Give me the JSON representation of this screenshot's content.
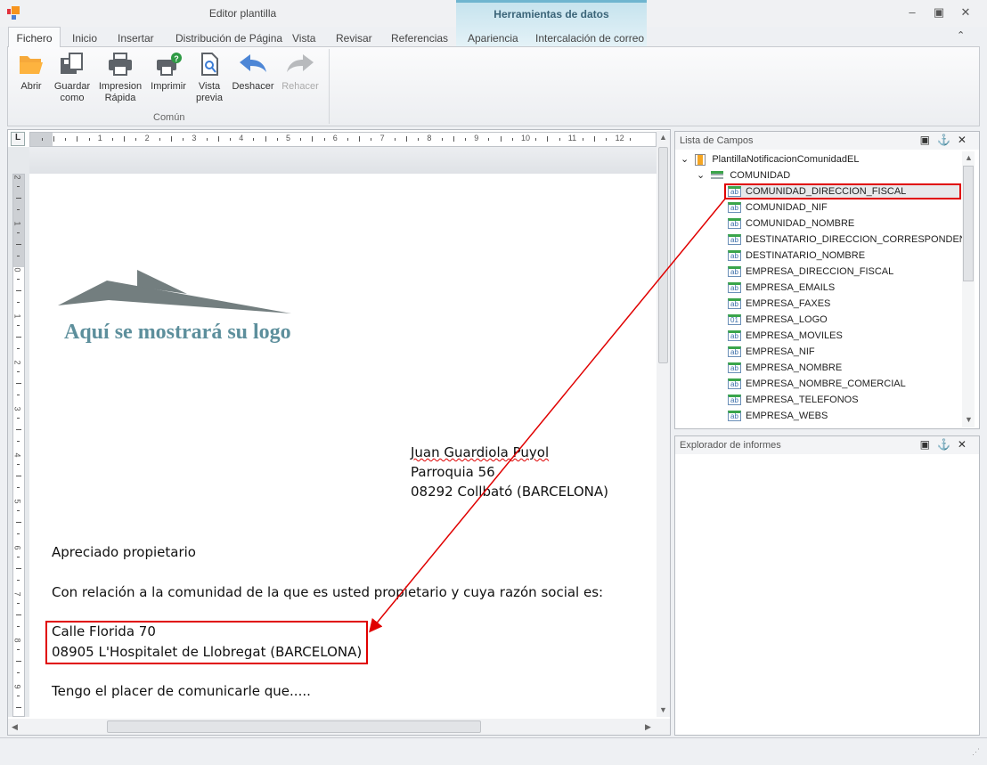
{
  "window": {
    "title": "Editor plantilla",
    "context_tab": "Herramientas de datos",
    "minimize": "–",
    "restore": "▣",
    "close": "✕",
    "collapse_ribbon": "⌃"
  },
  "tabs": [
    "Fichero",
    "Inicio",
    "Insertar",
    "Distribución de Página",
    "Vista",
    "Revisar",
    "Referencias",
    "Apariencia",
    "Intercalación de correo"
  ],
  "ribbon": {
    "group_label": "Común",
    "buttons": [
      {
        "l1": "Abrir",
        "l2": ""
      },
      {
        "l1": "Guardar",
        "l2": "como"
      },
      {
        "l1": "Impresion",
        "l2": "Rápida"
      },
      {
        "l1": "Imprimir",
        "l2": ""
      },
      {
        "l1": "Vista",
        "l2": "previa"
      },
      {
        "l1": "Deshacer",
        "l2": ""
      },
      {
        "l1": "Rehacer",
        "l2": ""
      }
    ]
  },
  "ruler": {
    "corner": "L",
    "h_numbers": [
      "1",
      "2",
      "3",
      "4",
      "5",
      "6",
      "7",
      "8",
      "9",
      "10",
      "11",
      "12"
    ],
    "v_numbers": [
      "2",
      "1",
      "0",
      "1",
      "2",
      "3",
      "4",
      "5",
      "6",
      "7",
      "8",
      "9"
    ]
  },
  "document": {
    "logo_text": "Aquí se mostrará su logo",
    "recipient": [
      "Juan Guardiola Puyol",
      "Parroquia 56",
      "08292 Collbató (BARCELONA)"
    ],
    "greeting": "Apreciado propietario",
    "intro": "Con relación a la comunidad de la que es usted propietario y cuya razón social es:",
    "address": [
      "Calle Florida 70",
      "08905 L'Hospitalet de Llobregat (BARCELONA)"
    ],
    "closing": "Tengo el placer de comunicarle que....."
  },
  "field_list": {
    "title": "Lista de Campos",
    "root": "PlantillaNotificacionComunidadEL",
    "table": "COMUNIDAD",
    "fields": [
      {
        "name": "COMUNIDAD_DIRECCION_FISCAL",
        "icon": "ab"
      },
      {
        "name": "COMUNIDAD_NIF",
        "icon": "ab"
      },
      {
        "name": "COMUNIDAD_NOMBRE",
        "icon": "ab"
      },
      {
        "name": "DESTINATARIO_DIRECCION_CORRESPONDEN...",
        "icon": "ab"
      },
      {
        "name": "DESTINATARIO_NOMBRE",
        "icon": "ab"
      },
      {
        "name": "EMPRESA_DIRECCION_FISCAL",
        "icon": "ab"
      },
      {
        "name": "EMPRESA_EMAILS",
        "icon": "ab"
      },
      {
        "name": "EMPRESA_FAXES",
        "icon": "ab"
      },
      {
        "name": "EMPRESA_LOGO",
        "icon": "01"
      },
      {
        "name": "EMPRESA_MOVILES",
        "icon": "ab"
      },
      {
        "name": "EMPRESA_NIF",
        "icon": "ab"
      },
      {
        "name": "EMPRESA_NOMBRE",
        "icon": "ab"
      },
      {
        "name": "EMPRESA_NOMBRE_COMERCIAL",
        "icon": "ab"
      },
      {
        "name": "EMPRESA_TELEFONOS",
        "icon": "ab"
      },
      {
        "name": "EMPRESA_WEBS",
        "icon": "ab"
      }
    ]
  },
  "report_explorer": {
    "title": "Explorador de informes"
  },
  "panel_icons": "▣⚓✕",
  "colors": {
    "highlight": "#e00000",
    "accent": "#6fb5cf"
  }
}
